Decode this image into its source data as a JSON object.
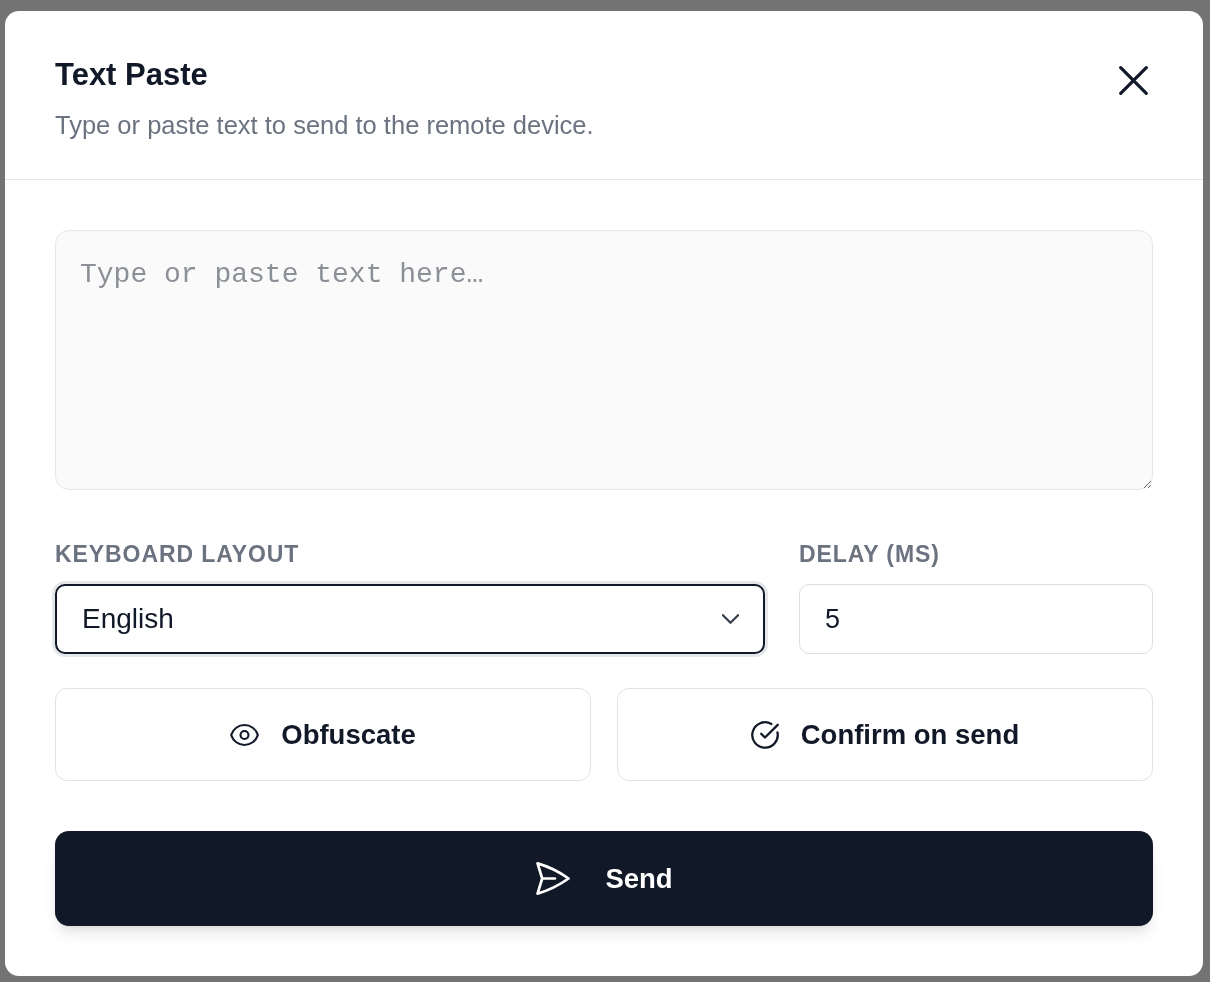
{
  "dialog": {
    "title": "Text Paste",
    "subtitle": "Type or paste text to send to the remote device."
  },
  "text_area": {
    "placeholder": "Type or paste text here…"
  },
  "keyboard_layout": {
    "label": "KEYBOARD LAYOUT",
    "value": "English",
    "focused": true
  },
  "delay": {
    "label": "DELAY (MS)",
    "value": "5"
  },
  "options": [
    {
      "kind": "obfuscate",
      "label": "Obfuscate"
    },
    {
      "kind": "confirm",
      "label": "Confirm on send"
    }
  ],
  "send_button": {
    "label": "Send"
  }
}
